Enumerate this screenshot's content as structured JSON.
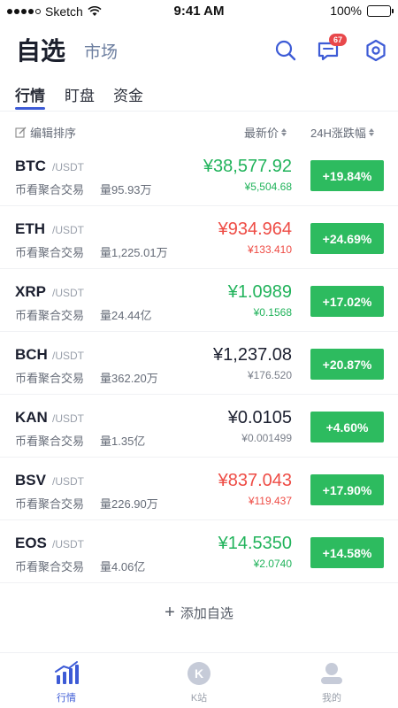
{
  "status_bar": {
    "carrier": "Sketch",
    "time": "9:41 AM",
    "battery": "100%",
    "signal_icon": "signal-dots-icon",
    "wifi_icon": "wifi-icon",
    "battery_icon": "battery-icon"
  },
  "header": {
    "title": "自选",
    "market_link": "市场",
    "message_badge": "67",
    "icons": [
      "search-icon",
      "message-icon",
      "settings-icon"
    ]
  },
  "tabs": [
    {
      "label": "行情",
      "active": true
    },
    {
      "label": "盯盘",
      "active": false
    },
    {
      "label": "资金",
      "active": false
    }
  ],
  "columns": {
    "edit_sort": "编辑排序",
    "price": "最新价",
    "change": "24H涨跌幅"
  },
  "coins": [
    {
      "symbol": "BTC",
      "quote": "/USDT",
      "exchange": "币看聚合交易",
      "volume": "量95.93万",
      "price": "¥38,577.92",
      "price_cny": "¥5,504.68",
      "change": "+19.84%",
      "trend": "up"
    },
    {
      "symbol": "ETH",
      "quote": "/USDT",
      "exchange": "币看聚合交易",
      "volume": "量1,225.01万",
      "price": "¥934.964",
      "price_cny": "¥133.410",
      "change": "+24.69%",
      "trend": "down"
    },
    {
      "symbol": "XRP",
      "quote": "/USDT",
      "exchange": "币看聚合交易",
      "volume": "量24.44亿",
      "price": "¥1.0989",
      "price_cny": "¥0.1568",
      "change": "+17.02%",
      "trend": "up"
    },
    {
      "symbol": "BCH",
      "quote": "/USDT",
      "exchange": "币看聚合交易",
      "volume": "量362.20万",
      "price": "¥1,237.08",
      "price_cny": "¥176.520",
      "change": "+20.87%",
      "trend": "flat"
    },
    {
      "symbol": "KAN",
      "quote": "/USDT",
      "exchange": "币看聚合交易",
      "volume": "量1.35亿",
      "price": "¥0.0105",
      "price_cny": "¥0.001499",
      "change": "+4.60%",
      "trend": "flat"
    },
    {
      "symbol": "BSV",
      "quote": "/USDT",
      "exchange": "币看聚合交易",
      "volume": "量226.90万",
      "price": "¥837.043",
      "price_cny": "¥119.437",
      "change": "+17.90%",
      "trend": "down"
    },
    {
      "symbol": "EOS",
      "quote": "/USDT",
      "exchange": "币看聚合交易",
      "volume": "量4.06亿",
      "price": "¥14.5350",
      "price_cny": "¥2.0740",
      "change": "+14.58%",
      "trend": "up"
    }
  ],
  "add_favorite": "添加自选",
  "bottom_nav": [
    {
      "label": "行情",
      "icon": "market-chart-icon",
      "active": true
    },
    {
      "label": "K站",
      "icon": "k-station-icon",
      "active": false
    },
    {
      "label": "我的",
      "icon": "profile-icon",
      "active": false
    }
  ],
  "colors": {
    "accent": "#3d5bd6",
    "up": "#21b35b",
    "down": "#ee4c45",
    "flat": "#1c2030",
    "change_badge": "#2dbb5f",
    "inactive": "#9aa0ab"
  }
}
